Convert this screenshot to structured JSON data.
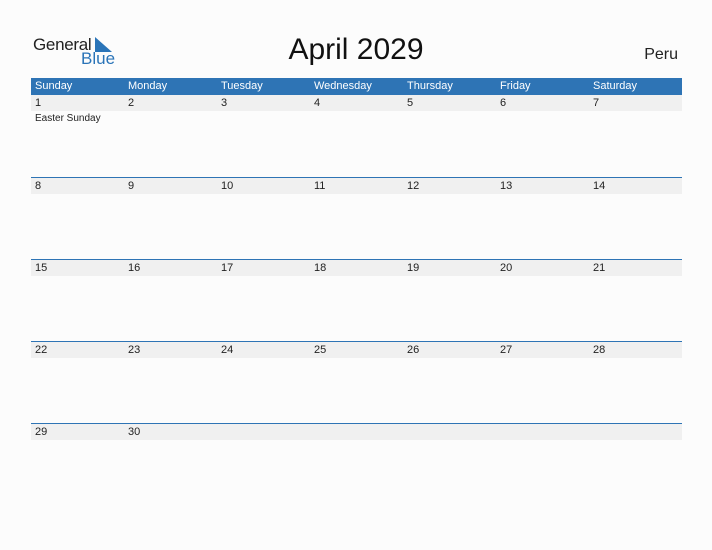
{
  "logo": {
    "general": "General",
    "blue": "Blue"
  },
  "title": "April 2029",
  "country": "Peru",
  "weekdays": [
    "Sunday",
    "Monday",
    "Tuesday",
    "Wednesday",
    "Thursday",
    "Friday",
    "Saturday"
  ],
  "weeks": [
    {
      "days": [
        "1",
        "2",
        "3",
        "4",
        "5",
        "6",
        "7"
      ],
      "events": [
        "Easter Sunday",
        "",
        "",
        "",
        "",
        "",
        ""
      ]
    },
    {
      "days": [
        "8",
        "9",
        "10",
        "11",
        "12",
        "13",
        "14"
      ],
      "events": [
        "",
        "",
        "",
        "",
        "",
        "",
        ""
      ]
    },
    {
      "days": [
        "15",
        "16",
        "17",
        "18",
        "19",
        "20",
        "21"
      ],
      "events": [
        "",
        "",
        "",
        "",
        "",
        "",
        ""
      ]
    },
    {
      "days": [
        "22",
        "23",
        "24",
        "25",
        "26",
        "27",
        "28"
      ],
      "events": [
        "",
        "",
        "",
        "",
        "",
        "",
        ""
      ]
    },
    {
      "days": [
        "29",
        "30",
        "",
        "",
        "",
        "",
        ""
      ],
      "events": [
        "",
        "",
        "",
        "",
        "",
        "",
        ""
      ]
    }
  ],
  "colors": {
    "header": "#2e74b5",
    "day_band": "#f0f0f0",
    "logo_blue": "#2a74b8"
  }
}
